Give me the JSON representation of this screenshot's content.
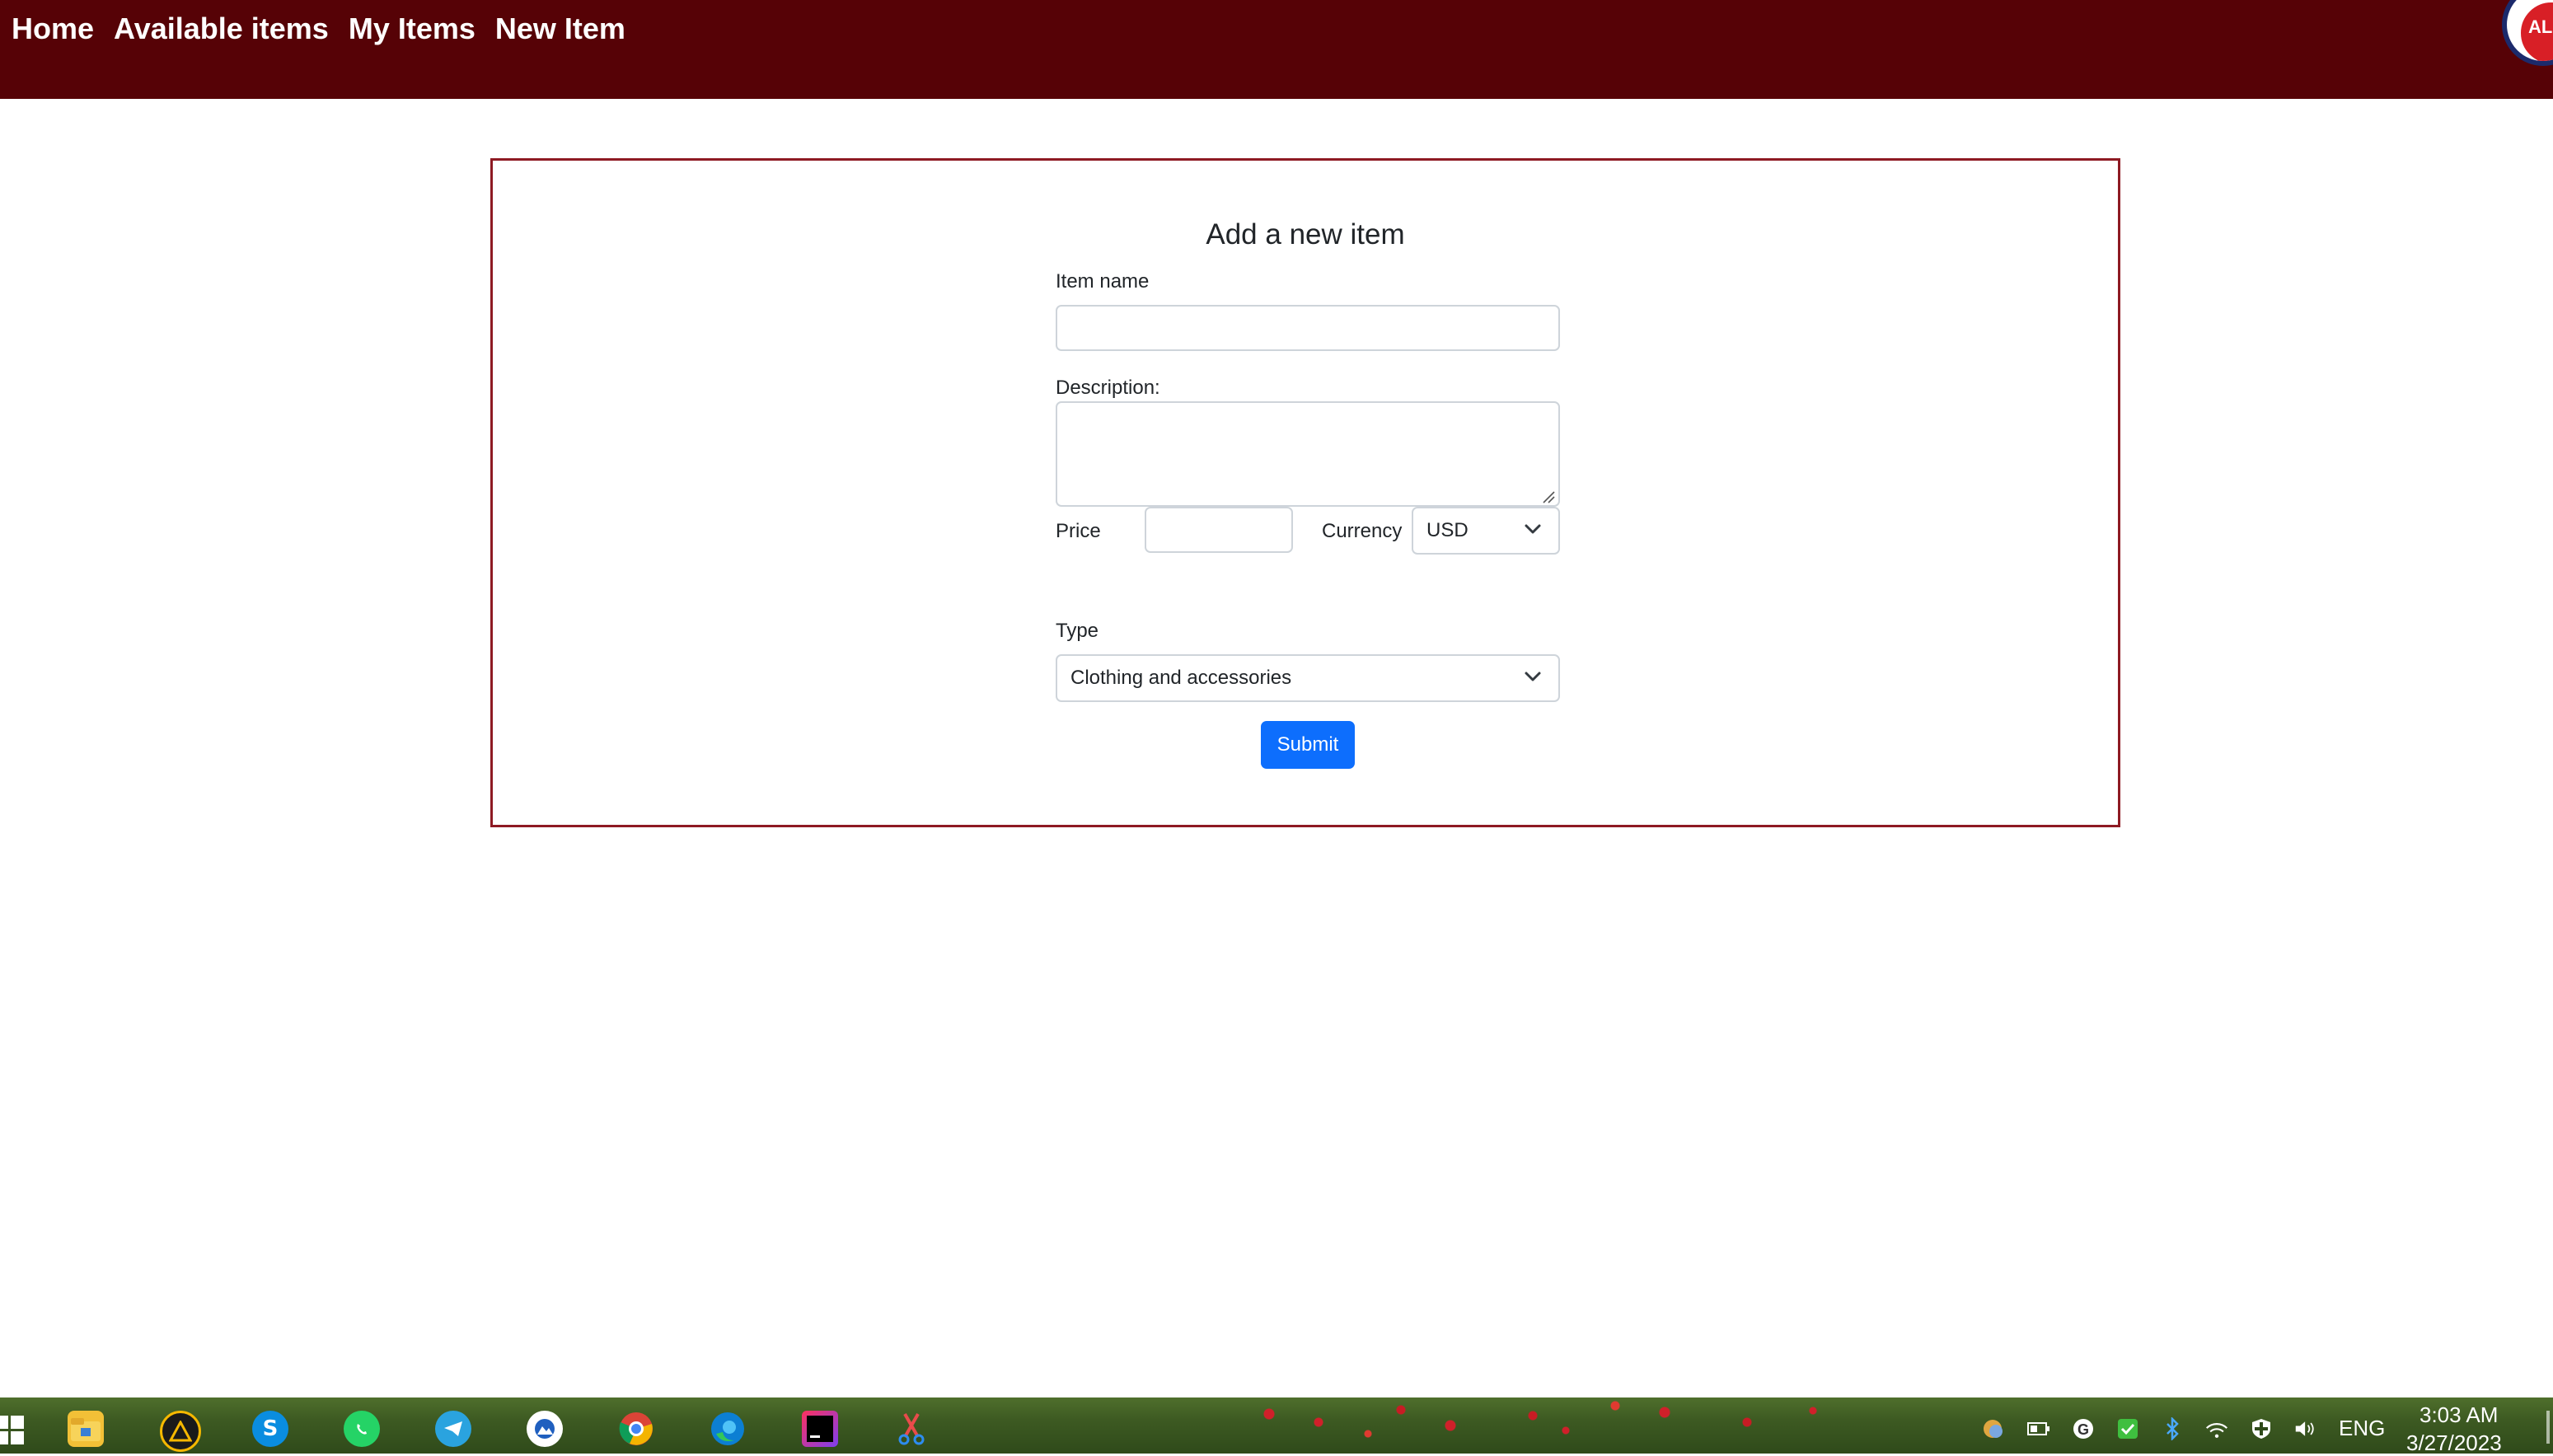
{
  "nav": {
    "links": [
      "Home",
      "Available items",
      "My Items",
      "New Item"
    ]
  },
  "form": {
    "title": "Add a new item",
    "item_name_label": "Item name",
    "item_name_value": "",
    "description_label": "Description:",
    "description_value": "",
    "price_label": "Price",
    "price_value": "",
    "currency_label": "Currency",
    "currency_selected": "USD",
    "type_label": "Type",
    "type_selected": "Clothing and accessories",
    "submit_label": "Submit"
  },
  "colors": {
    "navbar": "#560206",
    "card_border": "#8e1a23",
    "submit": "#0d6efd"
  },
  "taskbar": {
    "icons": [
      "windows-start-icon",
      "file-explorer-icon",
      "warning-app-icon",
      "skype-icon",
      "whatsapp-icon",
      "telegram-icon",
      "photos-icon",
      "chrome-icon",
      "edge-icon",
      "intellij-icon",
      "snipping-tool-icon"
    ],
    "tray": {
      "language": "ENG",
      "time": "3:03 AM",
      "date": "3/27/2023"
    }
  }
}
